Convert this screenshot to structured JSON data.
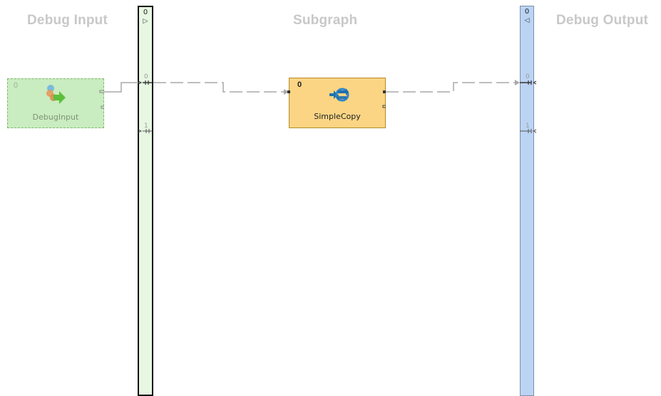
{
  "sections": {
    "input_title": "Debug Input",
    "subgraph_title": "Subgraph",
    "output_title": "Debug Output"
  },
  "input_bar": {
    "index": "0",
    "arrow": "▷",
    "ports": [
      "0",
      "1"
    ]
  },
  "output_bar": {
    "index": "0",
    "arrow": "◁",
    "ports": [
      "0",
      "1"
    ]
  },
  "nodes": {
    "debug_input": {
      "index": "0",
      "label": "DebugInput",
      "icon": "debug-input-icon"
    },
    "simple_copy": {
      "index": "0",
      "label": "SimpleCopy",
      "icon": "simple-copy-icon"
    }
  },
  "colors": {
    "input_bar": "#e6f7e2",
    "output_bar": "#bcd4f4",
    "debug_node": "#c9ecc0",
    "component_node": "#fbd584",
    "edge": "#a8a8a8"
  }
}
